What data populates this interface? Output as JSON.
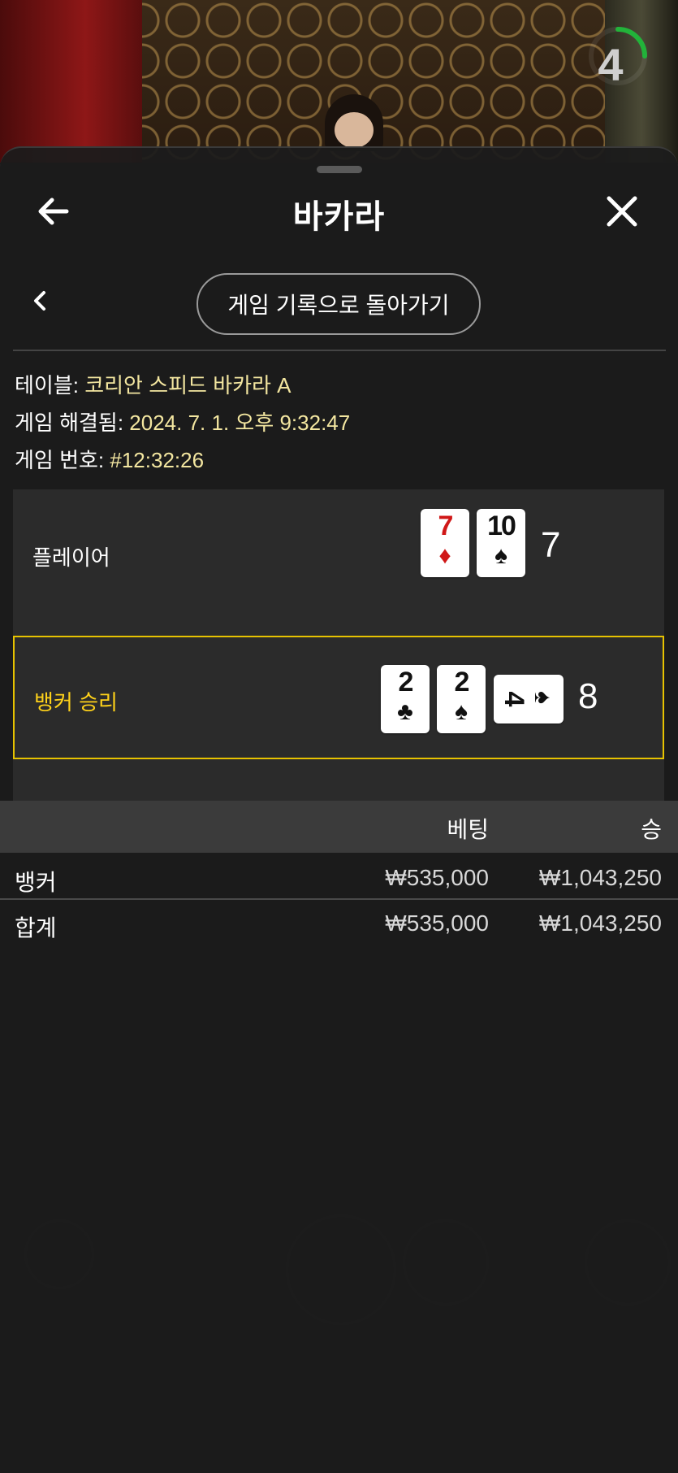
{
  "timer": {
    "value": "4",
    "progress": 0.3,
    "color": "#22b33a"
  },
  "header": {
    "title": "바카라"
  },
  "nav": {
    "back_to_history_label": "게임 기록으로 돌아가기"
  },
  "info": {
    "table_label": "테이블:",
    "table_value": "코리안 스피드 바카라 A",
    "resolved_label": "게임 해결됨:",
    "resolved_value": "2024. 7. 1. 오후 9:32:47",
    "game_no_label": "게임 번호:",
    "game_no_value": "#12:32:26"
  },
  "hands": {
    "player": {
      "label": "플레이어",
      "cards": [
        {
          "rank": "7",
          "suit": "♦"
        },
        {
          "rank": "10",
          "suit": "♠"
        }
      ],
      "total": "7"
    },
    "banker": {
      "label": "뱅커 승리",
      "cards": [
        {
          "rank": "2",
          "suit": "♣"
        },
        {
          "rank": "2",
          "suit": "♠"
        },
        {
          "rank": "4",
          "suit": "♠"
        }
      ],
      "total": "8"
    }
  },
  "bets": {
    "header": {
      "bet": "베팅",
      "win": "승"
    },
    "rows": [
      {
        "name": "뱅커",
        "bet": "₩535,000",
        "win": "₩1,043,250"
      }
    ],
    "total": {
      "name": "합계",
      "bet": "₩535,000",
      "win": "₩1,043,250"
    }
  },
  "colors": {
    "accent": "#ffd21a",
    "highlight_border": "#e6c200",
    "red_suit": "#d01818"
  }
}
